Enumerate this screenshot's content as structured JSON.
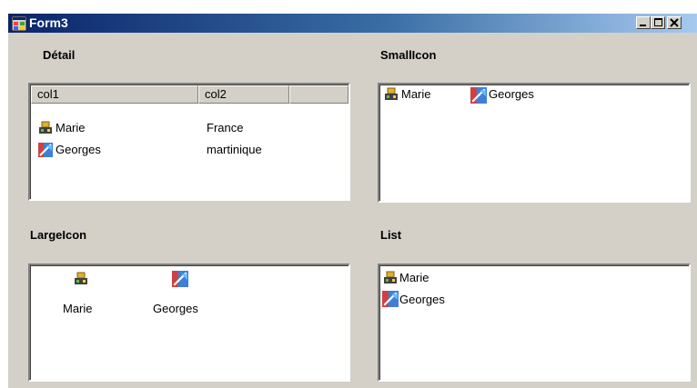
{
  "window": {
    "title": "Form3"
  },
  "groups": {
    "detail": {
      "label": "Détail",
      "columns": [
        "col1",
        "col2"
      ],
      "rows": [
        {
          "icon": "user-book-icon",
          "col1": "Marie",
          "col2": "France"
        },
        {
          "icon": "map-image-icon",
          "col1": "Georges",
          "col2": "martinique"
        }
      ]
    },
    "smallicon": {
      "label": "SmallIcon",
      "items": [
        {
          "icon": "user-book-icon",
          "label": "Marie"
        },
        {
          "icon": "map-image-icon",
          "label": "Georges"
        }
      ]
    },
    "largeicon": {
      "label": "LargeIcon",
      "items": [
        {
          "icon": "user-book-icon",
          "label": "Marie"
        },
        {
          "icon": "map-image-icon",
          "label": "Georges"
        }
      ]
    },
    "list": {
      "label": "List",
      "items": [
        {
          "icon": "user-book-icon",
          "label": "Marie"
        },
        {
          "icon": "map-image-icon",
          "label": "Georges"
        }
      ]
    }
  }
}
